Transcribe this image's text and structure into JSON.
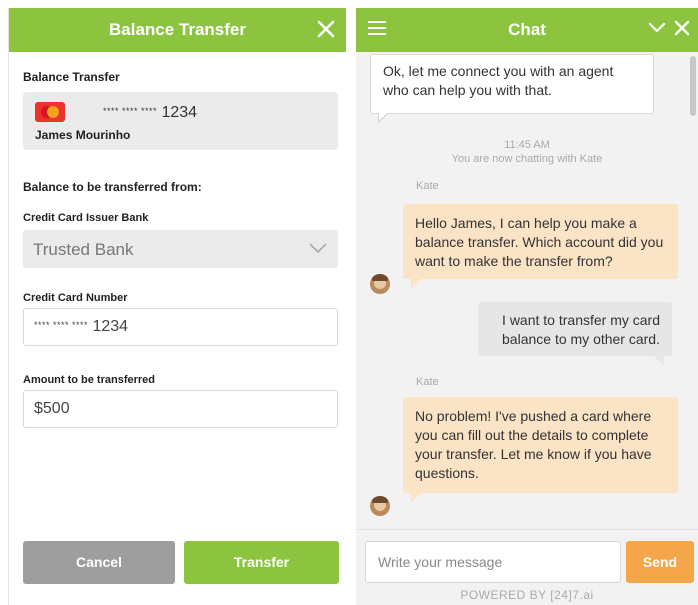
{
  "balance_panel": {
    "header_title": "Balance Transfer",
    "section_label": "Balance Transfer",
    "card": {
      "number_mask": "**** **** ****",
      "number_last4": "1234",
      "holder_name": "James Mourinho"
    },
    "from_label": "Balance to be transferred from:",
    "issuer_bank_label": "Credit Card Issuer Bank",
    "issuer_bank_value": "Trusted Bank",
    "card_number_label": "Credit Card Number",
    "card_number_mask": "**** **** ****",
    "card_number_last4": "1234",
    "amount_label": "Amount to be transferred",
    "amount_value": "$500",
    "cancel_label": "Cancel",
    "transfer_label": "Transfer"
  },
  "chat": {
    "header_title": "Chat",
    "first_bot_message": "Ok, let me connect you with an agent who can help you with that.",
    "time": "11:45 AM",
    "status": "You are now chatting with Kate",
    "messages": [
      {
        "sender": "Kate",
        "text": "Hello James, I can help you make a balance transfer. Which account did you want to make the transfer from?"
      },
      {
        "sender": "",
        "text": "I want to transfer my card balance to my other card."
      },
      {
        "sender": "Kate",
        "text": "No problem! I've pushed a card where you can fill out the details to complete your transfer. Let me know if you have questions."
      }
    ],
    "input_placeholder": "Write your message",
    "send_label": "Send",
    "powered_by": "POWERED BY [24]7.ai"
  },
  "colors": {
    "green": "#8cc43f",
    "orange": "#f6a64a",
    "agent_bubble": "#fbe3c6",
    "user_bubble": "#e6e6e6",
    "cancel_gray": "#9e9e9e"
  },
  "icons": [
    "close-icon",
    "mastercard-icon",
    "chevron-down-icon",
    "hamburger-icon",
    "agent-avatar-icon"
  ]
}
